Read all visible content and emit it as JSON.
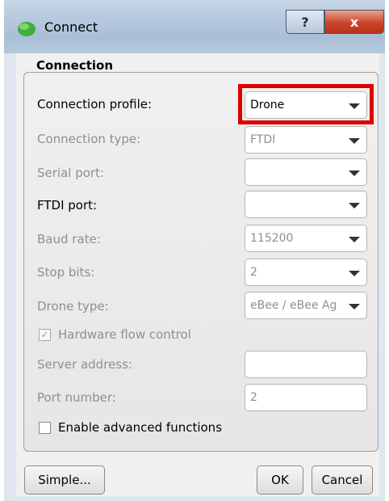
{
  "window": {
    "title": "Connect",
    "help_label": "?",
    "close_label": "x"
  },
  "tab": {
    "label": "Connection"
  },
  "fields": {
    "connection_profile": {
      "label": "Connection profile:",
      "value": "Drone"
    },
    "connection_type": {
      "label": "Connection type:",
      "value": "FTDI"
    },
    "serial_port": {
      "label": "Serial port:",
      "value": ""
    },
    "ftdi_port": {
      "label": "FTDI port:",
      "value": ""
    },
    "baud_rate": {
      "label": "Baud rate:",
      "value": "115200"
    },
    "stop_bits": {
      "label": "Stop bits:",
      "value": "2"
    },
    "drone_type": {
      "label": "Drone type:",
      "value": "eBee / eBee Ag"
    },
    "hardware_flow": {
      "label": "Hardware flow control",
      "checked": true
    },
    "server_address": {
      "label": "Server address:",
      "value": ""
    },
    "port_number": {
      "label": "Port number:",
      "value": "2"
    },
    "advanced": {
      "label": "Enable advanced functions",
      "checked": false
    }
  },
  "buttons": {
    "simple": "Simple...",
    "ok": "OK",
    "cancel": "Cancel"
  },
  "colors": {
    "highlight": "#e00000",
    "disabled_text": "#8f8f8f"
  },
  "icons": {
    "app": "green-leaf-icon",
    "dropdown": "chevron-down-icon",
    "check": "checkmark-icon"
  }
}
